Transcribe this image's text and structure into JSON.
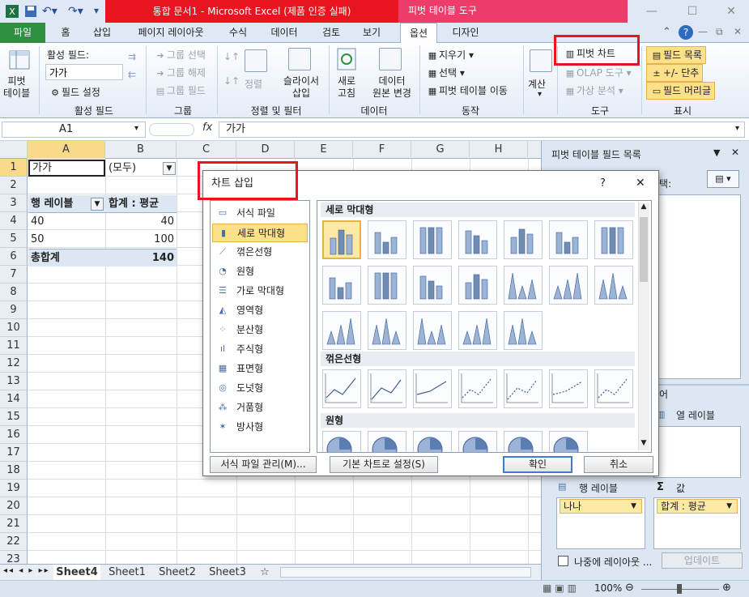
{
  "window": {
    "title": "통합 문서1 - Microsoft Excel (제품 인증 실패)",
    "contextual_tab": "피벗 테이블 도구"
  },
  "tabs": [
    "파일",
    "홈",
    "삽입",
    "페이지 레이아웃",
    "수식",
    "데이터",
    "검토",
    "보기",
    "옵션",
    "디자인"
  ],
  "ribbon": {
    "pivot_table_btn": "피벗\n테이블",
    "active_field_label": "활성 필드:",
    "active_field_value": "가가",
    "field_settings": "필드 설정",
    "group_active_field": "활성 필드",
    "group_selection": "그룹 선택",
    "ungroup": "그룹 해제",
    "group_field": "그룹 필드",
    "group_group": "그룹",
    "sort": "정렬",
    "insert_slicer": "슬라이서\n삽입",
    "group_sort_filter": "정렬 및 필터",
    "refresh": "새로\n고침",
    "change_source": "데이터\n원본 변경",
    "group_data": "데이터",
    "clear": "지우기",
    "select": "선택",
    "move_pivot": "피벗 테이블 이동",
    "group_actions": "동작",
    "calculations": "계산",
    "pivot_chart": "피벗 차트",
    "olap_tools": "OLAP 도구",
    "whatif": "가상 분석",
    "group_tools": "도구",
    "field_list": "필드 목록",
    "plus_minus": "+/- 단추",
    "field_headers": "필드 머리글",
    "group_show": "표시"
  },
  "formula_bar": {
    "name_box": "A1",
    "fx": "fx",
    "content": "가가"
  },
  "sheet": {
    "columns": [
      "A",
      "B",
      "C",
      "D",
      "E",
      "F",
      "G",
      "H"
    ],
    "rows": [
      "1",
      "2",
      "3",
      "4",
      "5",
      "6",
      "7",
      "8",
      "9",
      "10",
      "11",
      "12",
      "13",
      "14",
      "15",
      "16",
      "17",
      "18",
      "19",
      "20",
      "21",
      "22",
      "23"
    ],
    "a1": "가가",
    "b1": "(모두)",
    "a3": "행 레이블",
    "b3": "합계 : 평균",
    "a4": "40",
    "b4": "40",
    "a5": "50",
    "b5": "100",
    "a6": "총합계",
    "b6": "140"
  },
  "sheet_tabs": [
    "Sheet4",
    "Sheet1",
    "Sheet2",
    "Sheet3"
  ],
  "status": {
    "zoom": "100%"
  },
  "pane": {
    "title": "피벗 테이블 필드 목록",
    "choose_fields": "선택:",
    "drag_text": "끌어",
    "column_labels": "열 레이블",
    "row_labels": "행 레이블",
    "values": "값",
    "values_sigma": "Σ",
    "row_chip": "나나",
    "values_chip": "합계 : 평균",
    "defer_update": "나중에 레이아웃 ...",
    "update_btn": "업데이트"
  },
  "dialog": {
    "title": "차트 삽입",
    "help": "?",
    "close": "✕",
    "categories": [
      {
        "label": "서식 파일",
        "icon": "folder-icon",
        "glyph": "▭"
      },
      {
        "label": "세로 막대형",
        "icon": "column-chart-icon",
        "glyph": "▮"
      },
      {
        "label": "꺾은선형",
        "icon": "line-chart-icon",
        "glyph": "⟋"
      },
      {
        "label": "원형",
        "icon": "pie-chart-icon",
        "glyph": "◔"
      },
      {
        "label": "가로 막대형",
        "icon": "bar-chart-icon",
        "glyph": "☰"
      },
      {
        "label": "영역형",
        "icon": "area-chart-icon",
        "glyph": "◭"
      },
      {
        "label": "분산형",
        "icon": "scatter-chart-icon",
        "glyph": "⁘"
      },
      {
        "label": "주식형",
        "icon": "stock-chart-icon",
        "glyph": "ıl"
      },
      {
        "label": "표면형",
        "icon": "surface-chart-icon",
        "glyph": "▦"
      },
      {
        "label": "도넛형",
        "icon": "doughnut-chart-icon",
        "glyph": "◎"
      },
      {
        "label": "거품형",
        "icon": "bubble-chart-icon",
        "glyph": "⁂"
      },
      {
        "label": "방사형",
        "icon": "radar-chart-icon",
        "glyph": "✶"
      }
    ],
    "selected_category_index": 1,
    "section_column": "세로 막대형",
    "section_line": "꺾은선형",
    "section_pie": "원형",
    "manage_templates": "서식 파일 관리(M)...",
    "set_default": "기본 차트로 설정(S)",
    "ok": "확인",
    "cancel": "취소"
  },
  "colors": {
    "title_red": "#e8141f",
    "contextual_pink": "#ef3b6a",
    "file_green": "#2e8f3e",
    "highlight": "#fde08a"
  }
}
